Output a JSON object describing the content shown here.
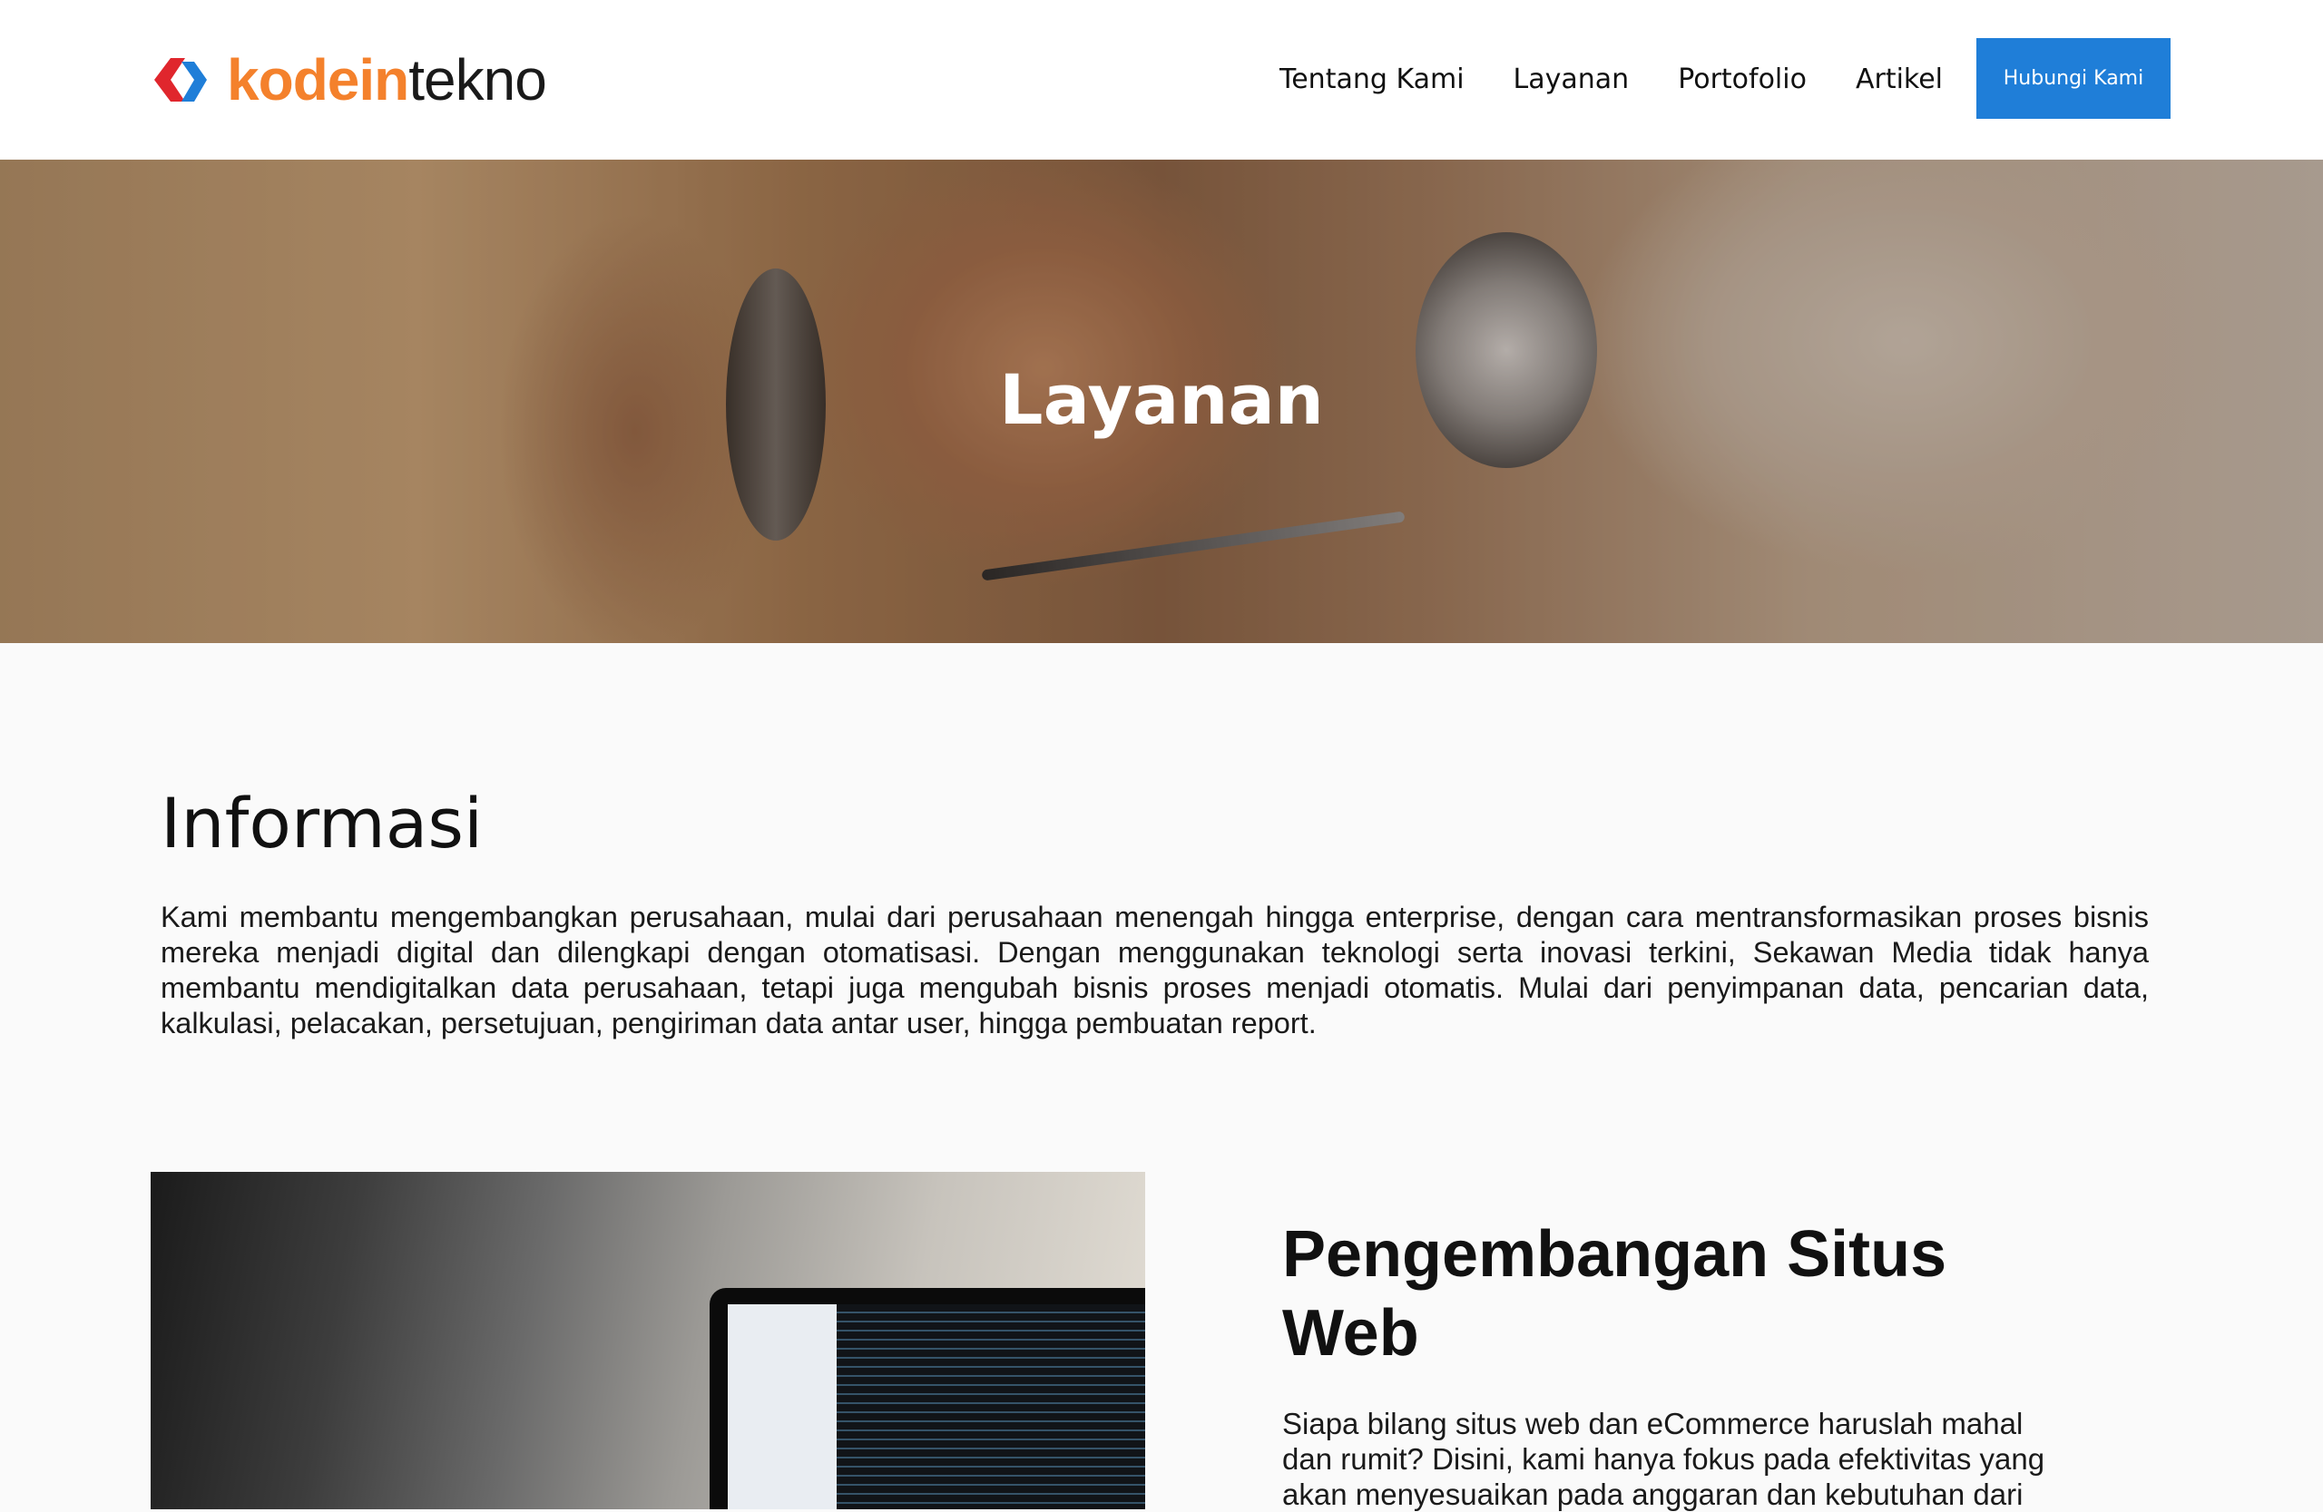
{
  "header": {
    "logo": {
      "part_bold": "kodein",
      "part_light": "tekno",
      "bold_color": "#f4812c"
    },
    "nav": [
      "Tentang Kami",
      "Layanan",
      "Portofolio",
      "Artikel"
    ],
    "cta_label": "Hubungi Kami",
    "accent_color": "#1f7ed8"
  },
  "hero": {
    "title": "Layanan"
  },
  "info": {
    "title": "Informasi",
    "body": "Kami membantu mengembangkan perusahaan, mulai dari perusahaan menengah hingga enterprise, dengan cara mentransformasikan proses bisnis mereka menjadi digital dan dilengkapi dengan otomatisasi. Dengan menggunakan teknologi serta inovasi terkini, Sekawan Media tidak hanya membantu mendigitalkan data perusahaan, tetapi juga mengubah bisnis proses menjadi otomatis. Mulai dari penyimpanan data, pencarian data, kalkulasi, pelacakan, persetujuan, pengiriman data antar user, hingga pembuatan report."
  },
  "service": {
    "title": "Pengembangan Situs Web",
    "body": "Siapa bilang situs web dan eCommerce haruslah mahal dan rumit? Disini, kami hanya fokus pada efektivitas yang akan menyesuaikan pada anggaran dan kebutuhan dari"
  }
}
